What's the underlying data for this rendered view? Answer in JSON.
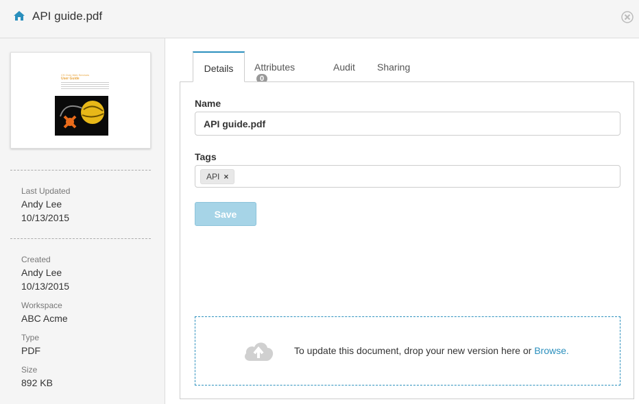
{
  "header": {
    "title": "API guide.pdf",
    "home_icon": "home-icon",
    "close_icon": "close-circle-icon"
  },
  "thumbnail": {
    "line1": "CS Civic Web Services",
    "line2": "User Guide"
  },
  "sidebar": {
    "last_updated": {
      "label": "Last Updated",
      "user": "Andy Lee",
      "date": "10/13/2015"
    },
    "created": {
      "label": "Created",
      "user": "Andy Lee",
      "date": "10/13/2015"
    },
    "workspace": {
      "label": "Workspace",
      "value": "ABC Acme"
    },
    "type": {
      "label": "Type",
      "value": "PDF"
    },
    "size": {
      "label": "Size",
      "value": "892 KB"
    }
  },
  "tabs": {
    "details": "Details",
    "attributes": "Attributes",
    "attributes_count": "0",
    "audit": "Audit",
    "sharing": "Sharing"
  },
  "form": {
    "name_label": "Name",
    "name_value": "API guide.pdf",
    "tags_label": "Tags",
    "tags": [
      "API"
    ],
    "tag_remove": "×",
    "save_label": "Save"
  },
  "dropzone": {
    "text": "To update this document, drop your new version here or ",
    "browse": "Browse",
    "period": "."
  },
  "colors": {
    "accent": "#2a8fbd",
    "save_bg": "#a6d4e7"
  }
}
